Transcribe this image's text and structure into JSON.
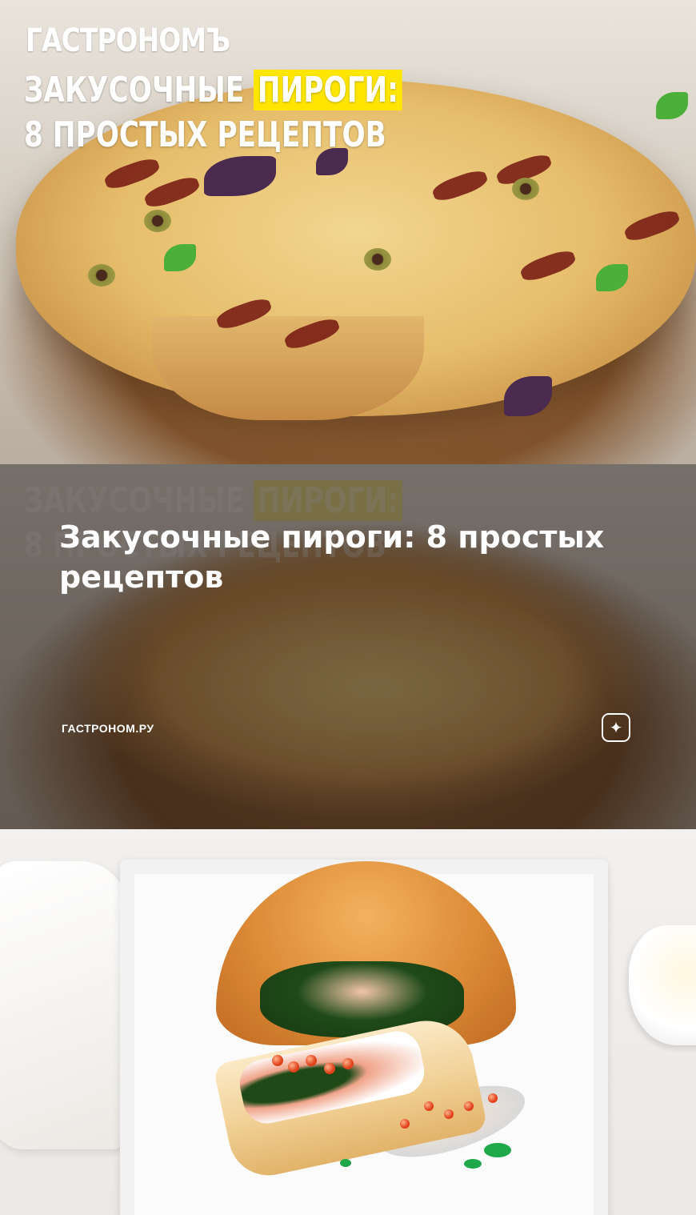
{
  "hero": {
    "brand": "ГАСТРОНОМЪ",
    "headline_line1_prefix": "ЗАКУСОЧНЫЕ ",
    "headline_line1_highlight": "ПИРОГИ:",
    "headline_line2": "8 ПРОСТЫХ РЕЦЕПТОВ",
    "highlight_color": "#ffe600"
  },
  "card": {
    "title": "Закусочные пироги: 8 простых рецептов",
    "source": "ГАСТРОНОМ.РУ",
    "action_icon": "sparkle-icon"
  }
}
